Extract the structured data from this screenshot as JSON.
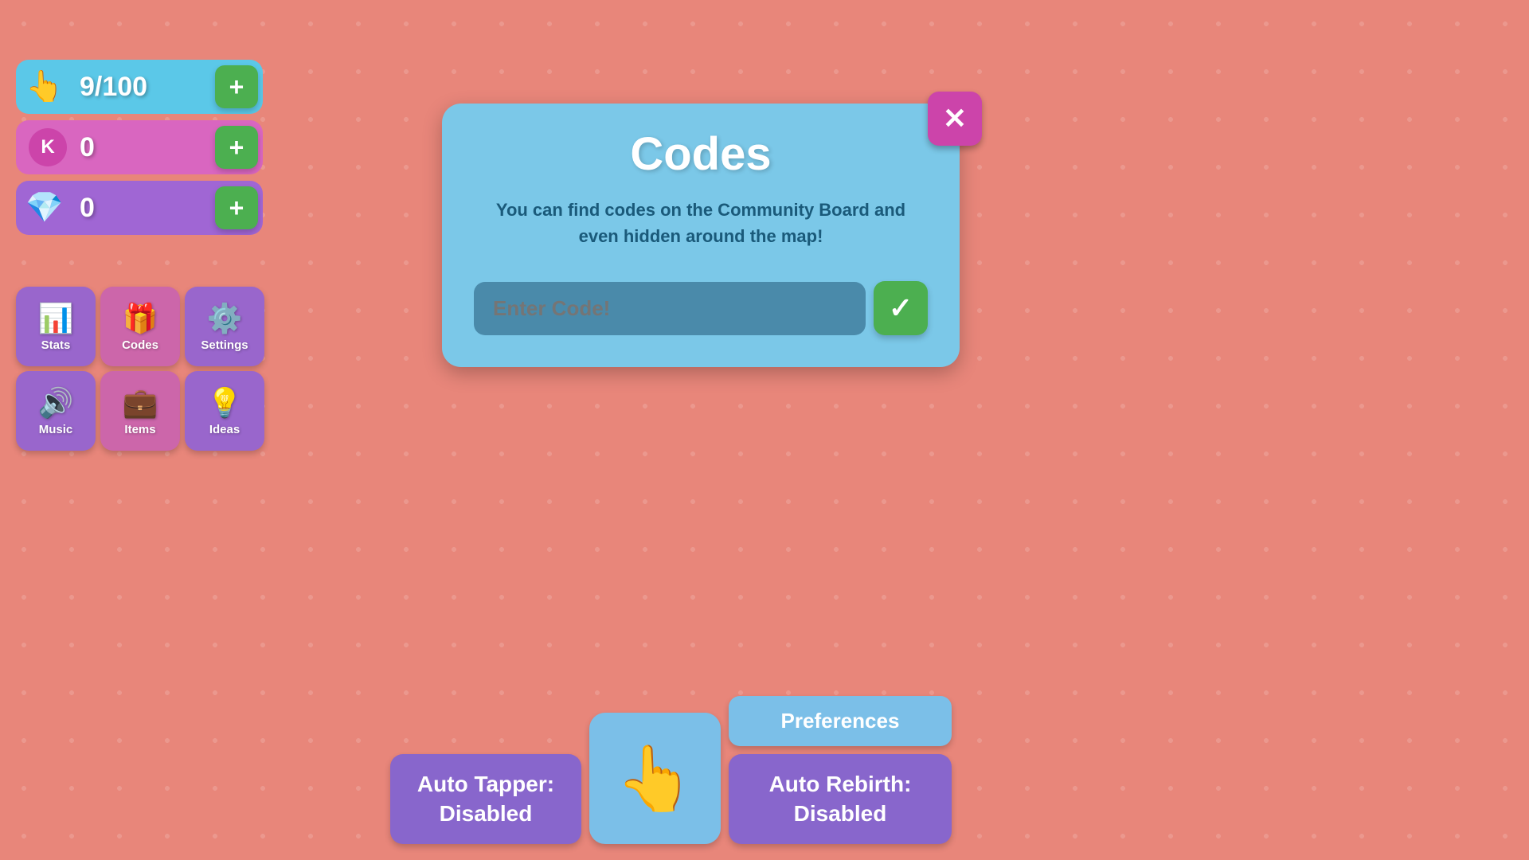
{
  "counters": [
    {
      "id": "clicks",
      "icon": "👆",
      "value": "9/100",
      "color": "blue"
    },
    {
      "id": "k-coins",
      "icon": "K",
      "value": "0",
      "color": "pink"
    },
    {
      "id": "diamonds",
      "icon": "💎",
      "value": "0",
      "color": "purple"
    }
  ],
  "action_buttons": {
    "row1": [
      {
        "id": "stats",
        "icon": "📊",
        "label": "Stats"
      },
      {
        "id": "codes",
        "icon": "🎁",
        "label": "Codes"
      },
      {
        "id": "settings",
        "icon": "⚙️",
        "label": "Settings"
      }
    ],
    "row2": [
      {
        "id": "music",
        "icon": "🔊",
        "label": "Music"
      },
      {
        "id": "items",
        "icon": "💼",
        "label": "Items"
      },
      {
        "id": "ideas",
        "icon": "💡",
        "label": "Ideas"
      }
    ]
  },
  "codes_modal": {
    "title": "Codes",
    "description": "You can find codes on the Community Board and even hidden around the map!",
    "input_placeholder": "Enter Code!",
    "submit_label": "✓"
  },
  "close_button": "✕",
  "bottom_panel": {
    "auto_tapper": "Auto Tapper:\nDisabled",
    "tap_icon": "👆",
    "preferences": "Preferences",
    "auto_rebirth": "Auto Rebirth:\nDisabled"
  }
}
